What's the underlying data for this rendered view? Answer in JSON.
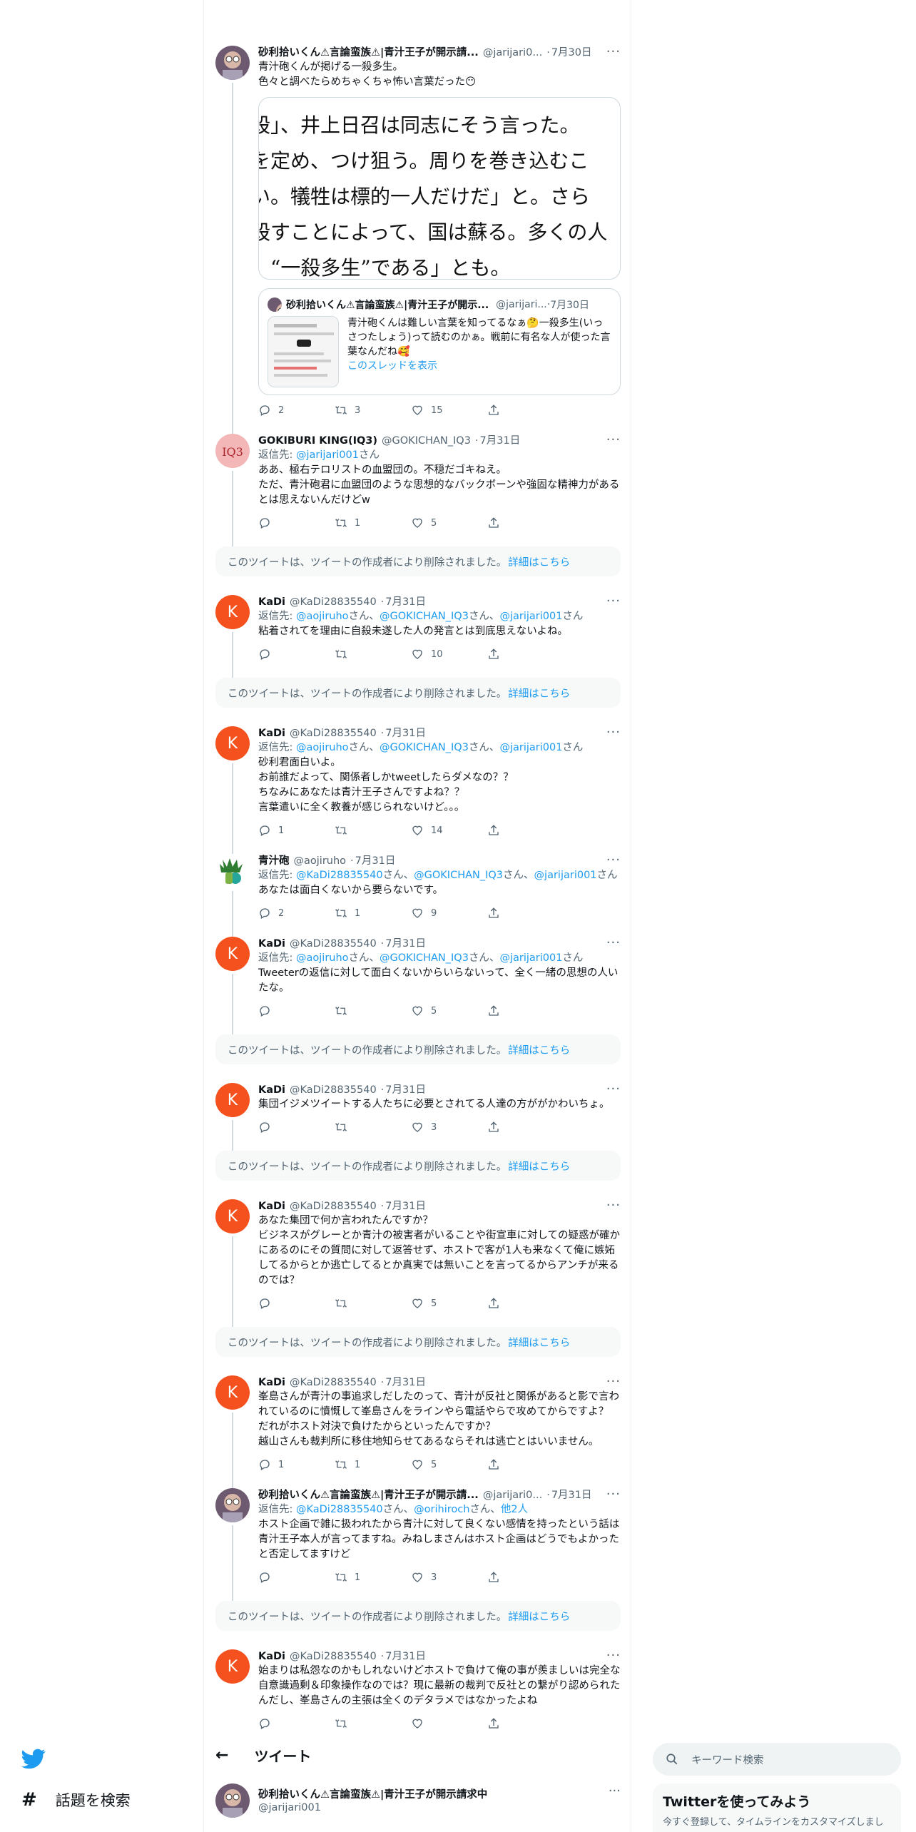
{
  "nav": {
    "explore_label": "話題を検索"
  },
  "header": {
    "title": "ツイート"
  },
  "search": {
    "placeholder": "キーワード検索"
  },
  "signup_card": {
    "title": "Twitterを使ってみよう",
    "subtitle": "今すぐ登録して、タイムラインをカスタマイズしまし"
  },
  "deleted_notice": {
    "text": "このツイートは、ツイートの作成者により削除されました。",
    "link": "詳細はこちら"
  },
  "reply_prefix": "返信先: ",
  "main_tweet": {
    "name": "砂利拾いくん⚠言論蛮族⚠|青汁王子が開示請求中",
    "handle": "@jarijari001"
  },
  "feed": [
    {
      "kind": "tweet",
      "avatar": "jari",
      "name": "砂利拾いくん⚠言論蛮族⚠|青汁王子が開示請...",
      "handle": "@jarijari0...",
      "date": "7月30日",
      "text": "青汁砲くんが掲げる一殺多生。\n色々と調べたらめちゃくちゃ怖い言葉だった😶",
      "media": {
        "lines": [
          "一殺」、井上日召は同志にそう言った。",
          "的を定め、つけ狙う。周りを巻き込むこ",
          "ない。犠牲は標的一人だけだ」と。さら",
          "を殺すことによって、国は蘇る。多くの人",
          "る。“一殺多生”である」とも。"
        ]
      },
      "quote": {
        "name": "砂利拾いくん⚠言論蛮族⚠|青汁王子が開示...",
        "handle": "@jarijari...",
        "date": "7月30日",
        "text": "青汁砲くんは難しい言葉を知ってるなぁ🤔一殺多生(いっさつたしょう)って読むのかぁ。戦前に有名な人が使った言葉なんだね🥰",
        "link": "このスレッドを表示"
      },
      "replies": "2",
      "retweets": "3",
      "likes": "15",
      "line": true
    },
    {
      "kind": "tweet",
      "avatar": "iq3",
      "name": "GOKIBURI KING(IQ3)",
      "handle": "@GOKICHAN_IQ3",
      "date": "7月31日",
      "reply_to": [
        "@jarijari001"
      ],
      "text": "ああ、極右テロリストの血盟団の。不穏だゴキねえ。\nただ、青汁砲君に血盟団のような思想的なバックボーンや強固な精神力があるとは思えないんだけどw",
      "replies": "",
      "retweets": "1",
      "likes": "5",
      "line": true
    },
    {
      "kind": "deleted"
    },
    {
      "kind": "tweet",
      "avatar": "kadi",
      "name": "KaDi",
      "handle": "@KaDi28835540",
      "date": "7月31日",
      "reply_to": [
        "@aojiruho",
        "@GOKICHAN_IQ3",
        "@jarijari001"
      ],
      "text": "粘着されてを理由に自殺未遂した人の発言とは到底思えないよね。",
      "replies": "",
      "retweets": "",
      "likes": "10",
      "line": true
    },
    {
      "kind": "deleted"
    },
    {
      "kind": "tweet",
      "avatar": "kadi",
      "name": "KaDi",
      "handle": "@KaDi28835540",
      "date": "7月31日",
      "reply_to": [
        "@aojiruho",
        "@GOKICHAN_IQ3",
        "@jarijari001"
      ],
      "text": "砂利君面白いよ。\nお前誰だよって、関係者しかtweetしたらダメなの？？\nちなみにあなたは青汁王子さんですよね？？\n言葉遣いに全く教養が感じられないけど。。。",
      "replies": "1",
      "retweets": "",
      "likes": "14",
      "line": true
    },
    {
      "kind": "tweet",
      "avatar": "aojiru",
      "name": "青汁砲",
      "handle": "@aojiruho",
      "date": "7月31日",
      "reply_to": [
        "@KaDi28835540",
        "@GOKICHAN_IQ3",
        "@jarijari001"
      ],
      "text": "あなたは面白くないから要らないです。",
      "replies": "2",
      "retweets": "1",
      "likes": "9",
      "line": true
    },
    {
      "kind": "tweet",
      "avatar": "kadi",
      "name": "KaDi",
      "handle": "@KaDi28835540",
      "date": "7月31日",
      "reply_to": [
        "@aojiruho",
        "@GOKICHAN_IQ3",
        "@jarijari001"
      ],
      "text": "Tweeterの返信に対して面白くないからいらないって、全く一緒の思想の人いたな。",
      "replies": "",
      "retweets": "",
      "likes": "5",
      "line": true
    },
    {
      "kind": "deleted"
    },
    {
      "kind": "tweet",
      "avatar": "kadi",
      "name": "KaDi",
      "handle": "@KaDi28835540",
      "date": "7月31日",
      "text": "集団イジメツイートする人たちに必要とされてる人達の方ががかわいちょ。",
      "replies": "",
      "retweets": "",
      "likes": "3",
      "line": true
    },
    {
      "kind": "deleted"
    },
    {
      "kind": "tweet",
      "avatar": "kadi",
      "name": "KaDi",
      "handle": "@KaDi28835540",
      "date": "7月31日",
      "text": "あなた集団で何か言われたんですか？\nビジネスがグレーとか青汁の被害者がいることや街宣車に対しての疑惑が確かにあるのにその質問に対して返答せず、ホストで客が1人も来なくて俺に嫉妬してるからとか逃亡してるとか真実では無いことを言ってるからアンチが来るのでは？",
      "replies": "",
      "retweets": "",
      "likes": "5",
      "line": true
    },
    {
      "kind": "deleted"
    },
    {
      "kind": "tweet",
      "avatar": "kadi",
      "name": "KaDi",
      "handle": "@KaDi28835540",
      "date": "7月31日",
      "text": "峯島さんが青汁の事追求しだしたのって、青汁が反社と関係があると影で言われているのに憤慨して峯島さんをラインやら電話やらで攻めてからですよ？\nだれがホスト対決で負けたからといったんですか？\n越山さんも裁判所に移住地知らせてあるならそれは逃亡とはいいません。",
      "replies": "1",
      "retweets": "1",
      "likes": "5",
      "line": true
    },
    {
      "kind": "tweet",
      "avatar": "jari",
      "name": "砂利拾いくん⚠言論蛮族⚠|青汁王子が開示請...",
      "handle": "@jarijari0...",
      "date": "7月31日",
      "reply_to": [
        "@KaDi28835540",
        "@orihiroch",
        "他2人"
      ],
      "text": "ホスト企画で雑に扱われたから青汁に対して良くない感情を持ったという話は青汁王子本人が言ってますね。みねしまさんはホスト企画はどうでもよかったと否定してますけど",
      "replies": "",
      "retweets": "1",
      "likes": "3",
      "line": true
    },
    {
      "kind": "deleted"
    },
    {
      "kind": "tweet",
      "avatar": "kadi",
      "name": "KaDi",
      "handle": "@KaDi28835540",
      "date": "7月31日",
      "text": "始まりは私怨なのかもしれないけどホストで負けて俺の事が羨ましいは完全な自意識過剰＆印象操作なのでは？現に最新の裁判で反社との繋がり認められたんだし、峯島さんの主張は全くのデタラメではなかったよね",
      "replies": "",
      "retweets": "",
      "likes": "",
      "line": false
    }
  ]
}
